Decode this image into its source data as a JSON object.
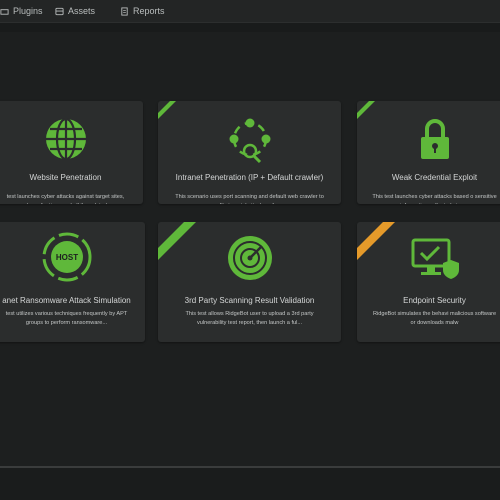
{
  "nav": {
    "items": [
      {
        "label": "Plugins",
        "icon": "plugin-icon"
      },
      {
        "label": "Assets",
        "icon": "assets-icon"
      },
      {
        "label": "Reports",
        "icon": "reports-icon"
      }
    ]
  },
  "colors": {
    "accent_green": "#5fb83a",
    "ribbon_orange": "#e59a2a",
    "background": "#1d1f1f",
    "card": "#2b2d2d"
  },
  "cards": [
    {
      "title": "Website Penetration",
      "desc": "test launches cyber attacks against target sites, web applications and all the related...",
      "icon": "globe-icon",
      "ribbon": null
    },
    {
      "title": "Intranet Penetration (IP + Default crawler)",
      "desc": "This scenario uses port scanning and default web crawler to profile targets' attack surface...",
      "icon": "network-search-icon",
      "ribbon": "green"
    },
    {
      "title": "Weak Credential Exploit",
      "desc": "This test launches cyber attacks based o sensitive information collected via we",
      "icon": "lock-icon",
      "ribbon": "green"
    },
    {
      "title": "anet Ransomware Attack Simulation",
      "desc": "test utilizes various techniques frequently by APT groups to perform ransomware...",
      "icon": "host-icon",
      "host_label": "HOST",
      "ribbon": null
    },
    {
      "title": "3rd Party Scanning Result Validation",
      "desc": "This test allows RidgeBot user to upload a 3rd party vulnerability test report, then launch a ful...",
      "icon": "radar-icon",
      "ribbon": "green"
    },
    {
      "title": "Endpoint Security",
      "desc": "RidgeBot simulates the behavi malicious software or downloads malw",
      "icon": "monitor-shield-icon",
      "ribbon": "orange"
    }
  ]
}
